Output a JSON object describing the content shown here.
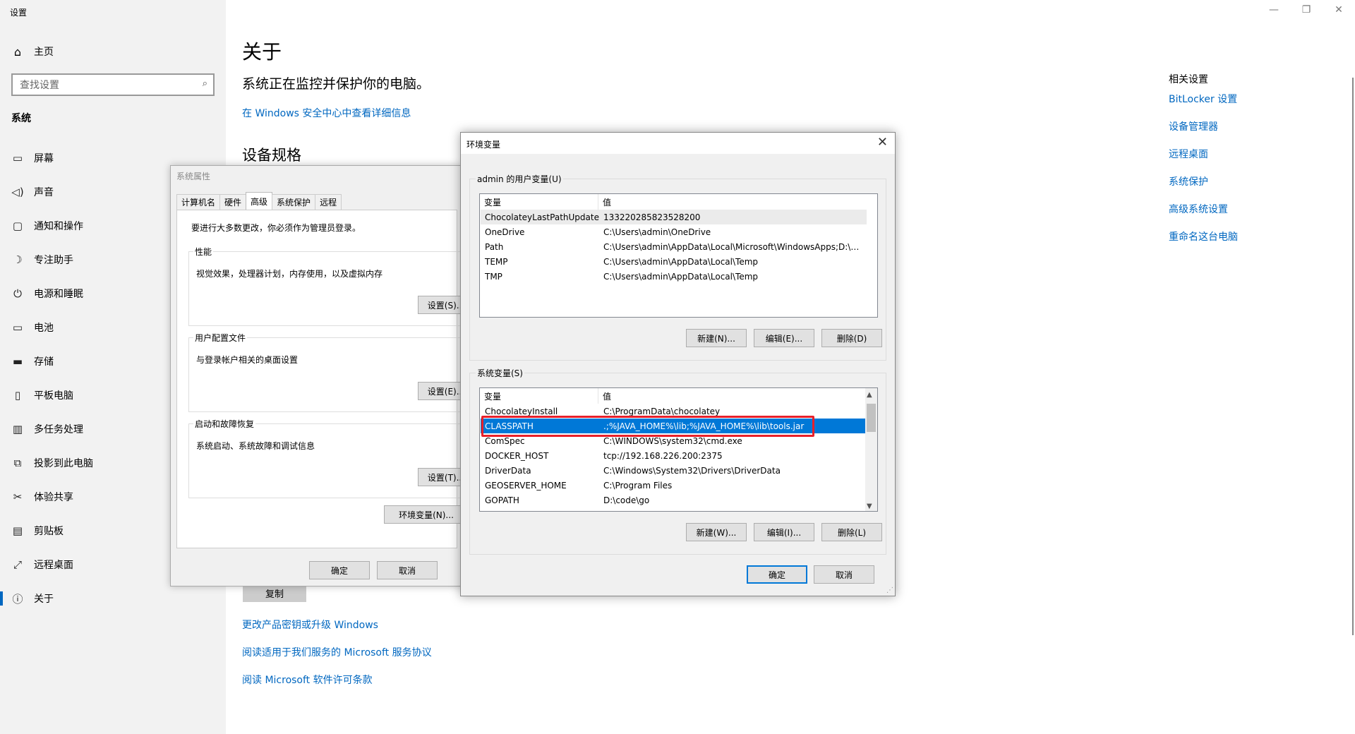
{
  "app": {
    "title": "设置",
    "window_controls": [
      "—",
      "❐",
      "✕"
    ]
  },
  "sidebar": {
    "home_label": "主页",
    "search_placeholder": "查找设置",
    "section_header": "系统",
    "items": [
      {
        "label": "屏幕",
        "icon": "monitor-icon"
      },
      {
        "label": "声音",
        "icon": "speaker-icon"
      },
      {
        "label": "通知和操作",
        "icon": "notification-icon"
      },
      {
        "label": "专注助手",
        "icon": "moon-icon"
      },
      {
        "label": "电源和睡眠",
        "icon": "power-icon"
      },
      {
        "label": "电池",
        "icon": "battery-icon"
      },
      {
        "label": "存储",
        "icon": "storage-icon"
      },
      {
        "label": "平板电脑",
        "icon": "tablet-icon"
      },
      {
        "label": "多任务处理",
        "icon": "multitask-icon"
      },
      {
        "label": "投影到此电脑",
        "icon": "project-icon"
      },
      {
        "label": "体验共享",
        "icon": "share-icon"
      },
      {
        "label": "剪贴板",
        "icon": "clipboard-icon"
      },
      {
        "label": "远程桌面",
        "icon": "remote-icon"
      },
      {
        "label": "关于",
        "icon": "info-icon"
      }
    ]
  },
  "main": {
    "title": "关于",
    "subtitle": "系统正在监控并保护你的电脑。",
    "security_link": "在 Windows 安全中心中查看详细信息",
    "spec_title": "设备规格",
    "copy_button": "复制",
    "link_upgrade": "更改产品密钥或升级 Windows",
    "link_service": "阅读适用于我们服务的 Microsoft 服务协议",
    "link_license": "阅读 Microsoft 软件许可条款"
  },
  "related": {
    "title": "相关设置",
    "links": [
      "BitLocker 设置",
      "设备管理器",
      "远程桌面",
      "系统保护",
      "高级系统设置",
      "重命名这台电脑"
    ]
  },
  "system_properties": {
    "title": "系统属性",
    "tabs": [
      "计算机名",
      "硬件",
      "高级",
      "系统保护",
      "远程"
    ],
    "notice": "要进行大多数更改，你必须作为管理员登录。",
    "performance": {
      "legend": "性能",
      "desc": "视觉效果，处理器计划，内存使用，以及虚拟内存",
      "button": "设置(S)..."
    },
    "user_profiles": {
      "legend": "用户配置文件",
      "desc": "与登录帐户相关的桌面设置",
      "button": "设置(E)..."
    },
    "startup": {
      "legend": "启动和故障恢复",
      "desc": "系统启动、系统故障和调试信息",
      "button": "设置(T)..."
    },
    "env_button": "环境变量(N)...",
    "ok": "确定",
    "cancel": "取消"
  },
  "env_vars": {
    "title": "环境变量",
    "user_group": "admin 的用户变量(U)",
    "system_group": "系统变量(S)",
    "col_var": "变量",
    "col_val": "值",
    "user_rows": [
      {
        "name": "ChocolateyLastPathUpdate",
        "value": "133220285823528200"
      },
      {
        "name": "OneDrive",
        "value": "C:\\Users\\admin\\OneDrive"
      },
      {
        "name": "Path",
        "value": "C:\\Users\\admin\\AppData\\Local\\Microsoft\\WindowsApps;D:\\l..."
      },
      {
        "name": "TEMP",
        "value": "C:\\Users\\admin\\AppData\\Local\\Temp"
      },
      {
        "name": "TMP",
        "value": "C:\\Users\\admin\\AppData\\Local\\Temp"
      }
    ],
    "system_rows": [
      {
        "name": "ChocolateyInstall",
        "value": "C:\\ProgramData\\chocolatey"
      },
      {
        "name": "CLASSPATH",
        "value": ".;%JAVA_HOME%\\lib;%JAVA_HOME%\\lib\\tools.jar"
      },
      {
        "name": "ComSpec",
        "value": "C:\\WINDOWS\\system32\\cmd.exe"
      },
      {
        "name": "DOCKER_HOST",
        "value": "tcp://192.168.226.200:2375"
      },
      {
        "name": "DriverData",
        "value": "C:\\Windows\\System32\\Drivers\\DriverData"
      },
      {
        "name": "GEOSERVER_HOME",
        "value": "C:\\Program Files"
      },
      {
        "name": "GOPATH",
        "value": "D:\\code\\go"
      }
    ],
    "user_buttons": [
      "新建(N)...",
      "编辑(E)...",
      "删除(D)"
    ],
    "system_buttons": [
      "新建(W)...",
      "编辑(I)...",
      "删除(L)"
    ],
    "ok": "确定",
    "cancel": "取消"
  },
  "colors": {
    "accent": "#0078d7",
    "link": "#0067c0",
    "highlight_outline": "#e8202a"
  }
}
